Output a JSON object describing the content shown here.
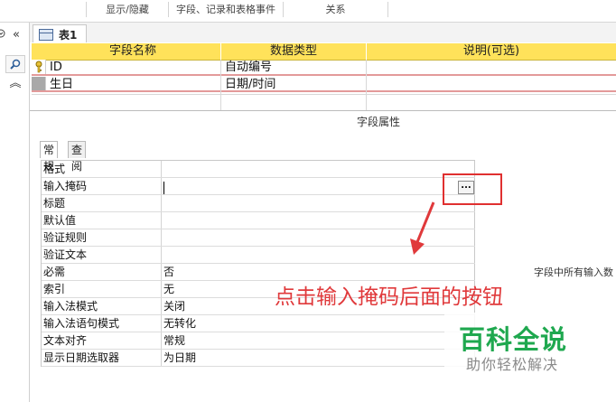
{
  "ribbon": {
    "groups": [
      "显示/隐藏",
      "字段、记录和表格事件",
      "关系"
    ]
  },
  "nav": {
    "collapse": "«",
    "search_icon": "search-icon",
    "expand": "︽"
  },
  "tab": {
    "label": "表1"
  },
  "grid": {
    "headers": {
      "name": "字段名称",
      "type": "数据类型",
      "desc": "说明(可选)"
    },
    "rows": [
      {
        "name": "ID",
        "type": "自动编号",
        "primary_key": true
      },
      {
        "name": "生日",
        "type": "日期/时间",
        "primary_key": false
      }
    ]
  },
  "properties": {
    "caption": "字段属性",
    "tabs": [
      "常规",
      "查阅"
    ],
    "rows": [
      {
        "label": "格式",
        "value": ""
      },
      {
        "label": "输入掩码",
        "value": ""
      },
      {
        "label": "标题",
        "value": ""
      },
      {
        "label": "默认值",
        "value": ""
      },
      {
        "label": "验证规则",
        "value": ""
      },
      {
        "label": "验证文本",
        "value": ""
      },
      {
        "label": "必需",
        "value": "否"
      },
      {
        "label": "索引",
        "value": "无"
      },
      {
        "label": "输入法模式",
        "value": "关闭"
      },
      {
        "label": "输入法语句模式",
        "value": "无转化"
      },
      {
        "label": "文本对齐",
        "value": "常规"
      },
      {
        "label": "显示日期选取器",
        "value": "为日期"
      }
    ],
    "builder_label": "...",
    "hint": "字段中所有输入数"
  },
  "annotation": {
    "text": "点击输入掩码后面的按钮",
    "color": "#e0393b"
  },
  "watermark": {
    "title": "百科全说",
    "subtitle": "助你轻松解决",
    "color": "#1fa84f"
  }
}
